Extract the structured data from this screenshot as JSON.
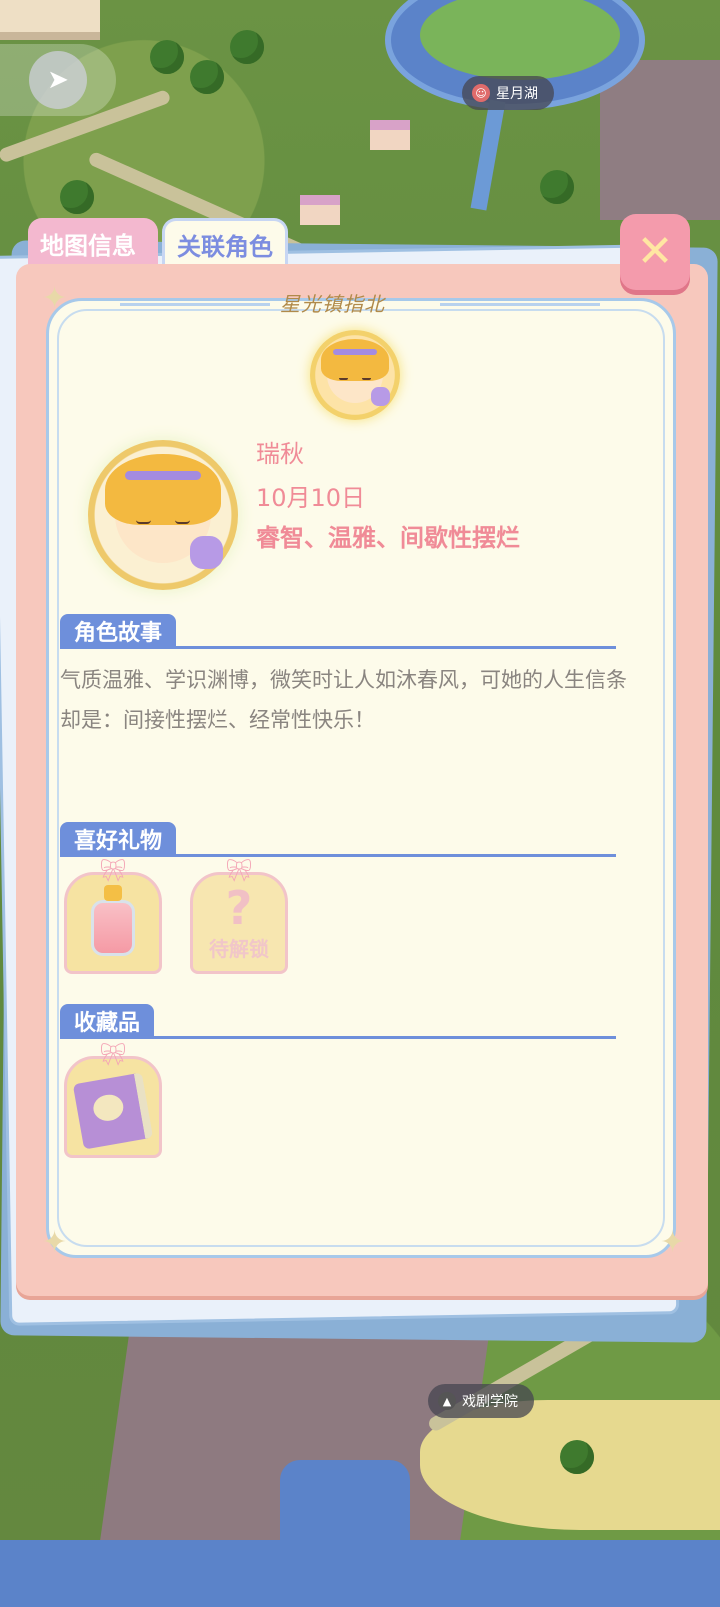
{
  "map": {
    "locations": [
      {
        "name": "星月湖",
        "icon": "theater-mask-icon"
      },
      {
        "name": "戏剧学院",
        "icon": "graduation-cap-icon"
      }
    ]
  },
  "tabs": [
    {
      "label": "地图信息",
      "active": false
    },
    {
      "label": "关联角色",
      "active": true
    }
  ],
  "panel": {
    "decor_title": "星光镇指北",
    "close_symbol": "✕"
  },
  "character": {
    "name": "瑞秋",
    "birthday": "10月10日",
    "traits": "睿智、温雅、间歇性摆烂"
  },
  "sections": {
    "story": {
      "title": "角色故事",
      "text": "气质温雅、学识渊博，微笑时让人如沐春风，可她的人生信条却是：间接性摆烂、经常性快乐！"
    },
    "gifts": {
      "title": "喜好礼物",
      "items": [
        {
          "icon": "perfume-bottle-icon",
          "locked": false
        },
        {
          "icon": "question-mark-icon",
          "locked": true,
          "label": "待解锁"
        }
      ]
    },
    "collections": {
      "title": "收藏品",
      "items": [
        {
          "icon": "book-icon"
        }
      ]
    }
  },
  "colors": {
    "accent_blue": "#6e8fdb",
    "pink_text": "#f08b97",
    "panel_frame": "#f7c8bd",
    "card_bg": "#f6e3a2"
  }
}
